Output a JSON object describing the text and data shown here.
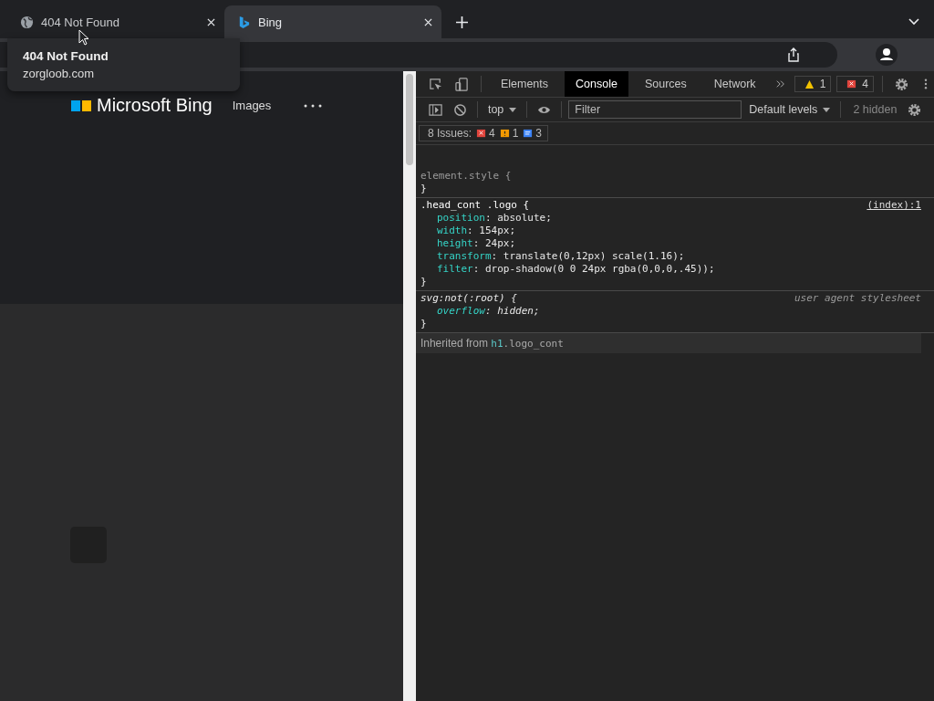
{
  "browser_tabs": [
    {
      "title": "404 Not Found",
      "selected": false
    },
    {
      "title": "Bing",
      "selected": true
    }
  ],
  "tab_tooltip": {
    "title": "404 Not Found",
    "url": "zorgloob.com"
  },
  "page": {
    "logo": "Microsoft Bing",
    "nav": [
      "Images"
    ]
  },
  "devtools": {
    "tabs": [
      {
        "label": "Elements",
        "selected": false
      },
      {
        "label": "Console",
        "selected": true
      },
      {
        "label": "Sources",
        "selected": false
      },
      {
        "label": "Network",
        "selected": false
      }
    ],
    "warning_count": "1",
    "error_count": "4",
    "console_toolbar": {
      "context": "top",
      "filter_placeholder": "Filter",
      "levels": "Default levels",
      "hidden": "2 hidden"
    },
    "issues": {
      "label": "8 Issues:",
      "errors": "4",
      "warnings": "1",
      "infos": "3"
    },
    "rules": [
      {
        "selector": "element.style {",
        "kind": "inline",
        "close": "}"
      },
      {
        "selector": ".head_cont .logo {",
        "kind": "author",
        "source": "(index):1",
        "declarations": [
          {
            "property": "position",
            "value": ": absolute;"
          },
          {
            "property": "width",
            "value": ": 154px;"
          },
          {
            "property": "height",
            "value": ": 24px;"
          },
          {
            "property": "transform",
            "value": ": translate(0,12px) scale(1.16);"
          },
          {
            "property": "filter",
            "value": ": drop-shadow(0 0 24px rgba(0,0,0,.45));"
          }
        ],
        "close": "}"
      },
      {
        "selector": "svg:not(:root) {",
        "kind": "user_agent",
        "source": "user agent stylesheet",
        "declarations": [
          {
            "property": "overflow",
            "value": ":  hidden;"
          }
        ],
        "close": "}"
      }
    ],
    "inherited": {
      "label": "Inherited from",
      "element": "h1",
      "selector": ".logo_cont"
    }
  }
}
